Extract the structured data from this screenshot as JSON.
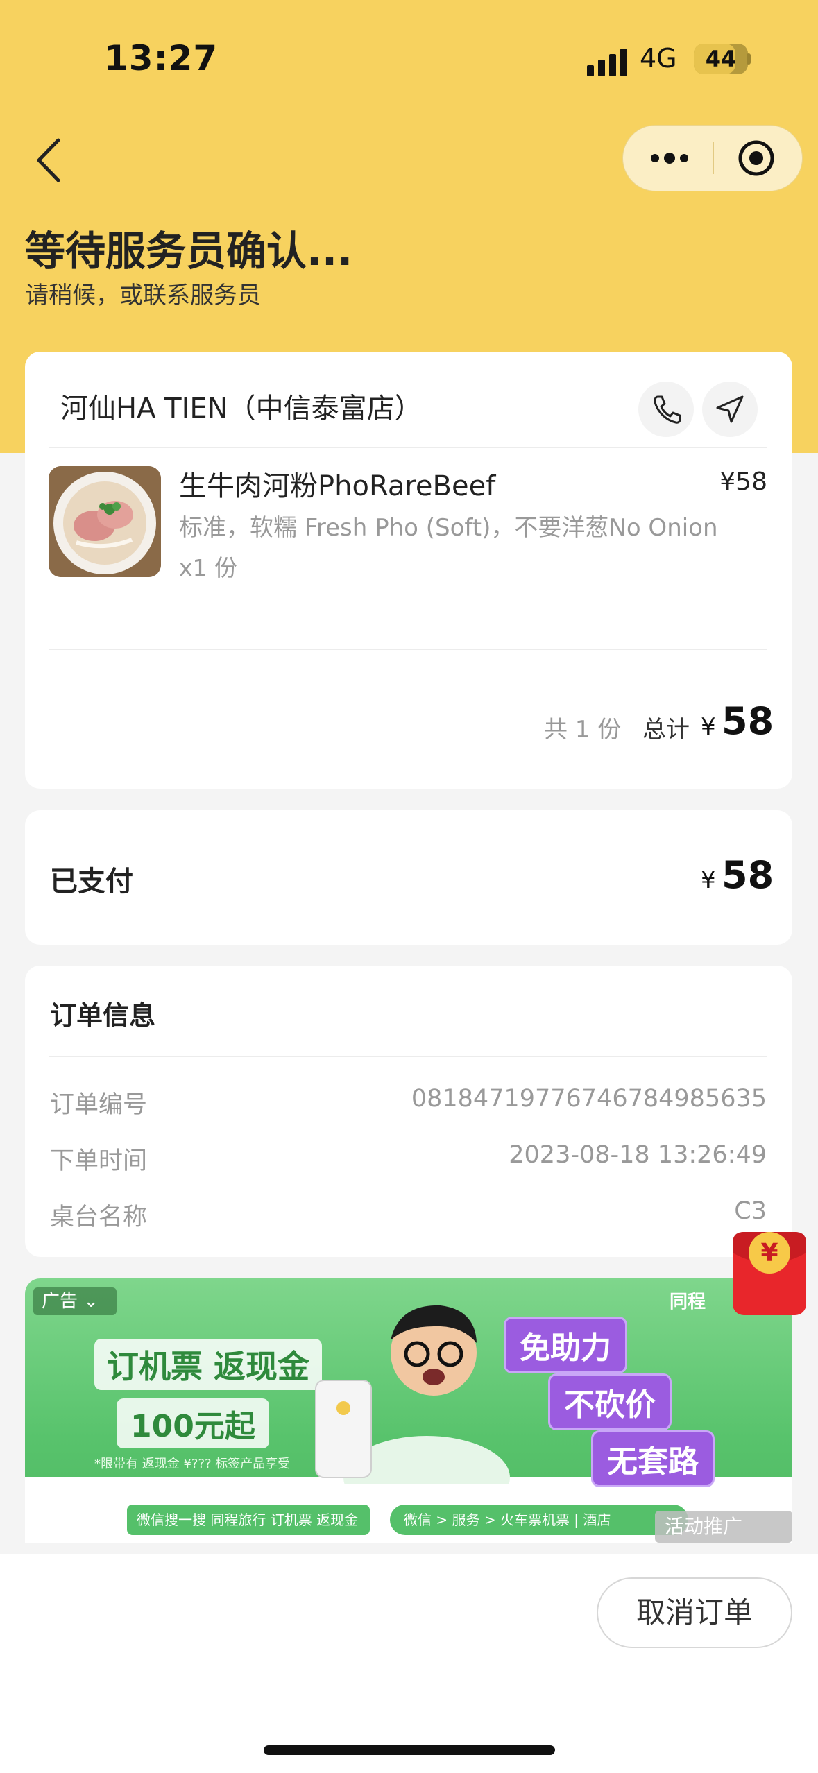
{
  "status_bar": {
    "time": "13:27",
    "network": "4G",
    "battery": "44"
  },
  "header": {
    "title": "等待服务员确认...",
    "subtitle": "请稍候，或联系服务员"
  },
  "store": {
    "name": "河仙HA TIEN（中信泰富店）"
  },
  "order_item": {
    "name": "生牛肉河粉PhoRareBeef",
    "price": "¥58",
    "spec": "标准，软糯 Fresh Pho (Soft)，不要洋葱No Onion",
    "qty": "x1 份"
  },
  "summary": {
    "count": "共 1 份",
    "total_label": "总计",
    "currency": "¥",
    "total": "58"
  },
  "payment": {
    "label": "已支付",
    "currency": "¥",
    "amount": "58"
  },
  "order_info": {
    "title": "订单信息",
    "rows": [
      {
        "label": "订单编号",
        "value": "0818471977674678498​5635"
      },
      {
        "label": "下单时间",
        "value": "2023-08-18 13:26:49"
      },
      {
        "label": "桌台名称",
        "value": "C3"
      }
    ]
  },
  "ad": {
    "tag": "广告",
    "brand": "同程",
    "headline": "订机票 返现金",
    "offer": "100元起",
    "note": "*限带有 返现金 ¥??? 标签产品享受",
    "bubbles": [
      "免助力",
      "不砍价",
      "无套路"
    ],
    "bar_left": "微信搜一搜  同程旅行  订机票 返现金",
    "bar_right": "微信 > 服务 > 火车票机票 | 酒店"
  },
  "promo_label": "活动推广",
  "actions": {
    "cancel": "取消订单"
  },
  "colors": {
    "header_bg": "#f7d25f",
    "card_bg": "#ffffff",
    "page_bg": "#f4f4f4"
  }
}
